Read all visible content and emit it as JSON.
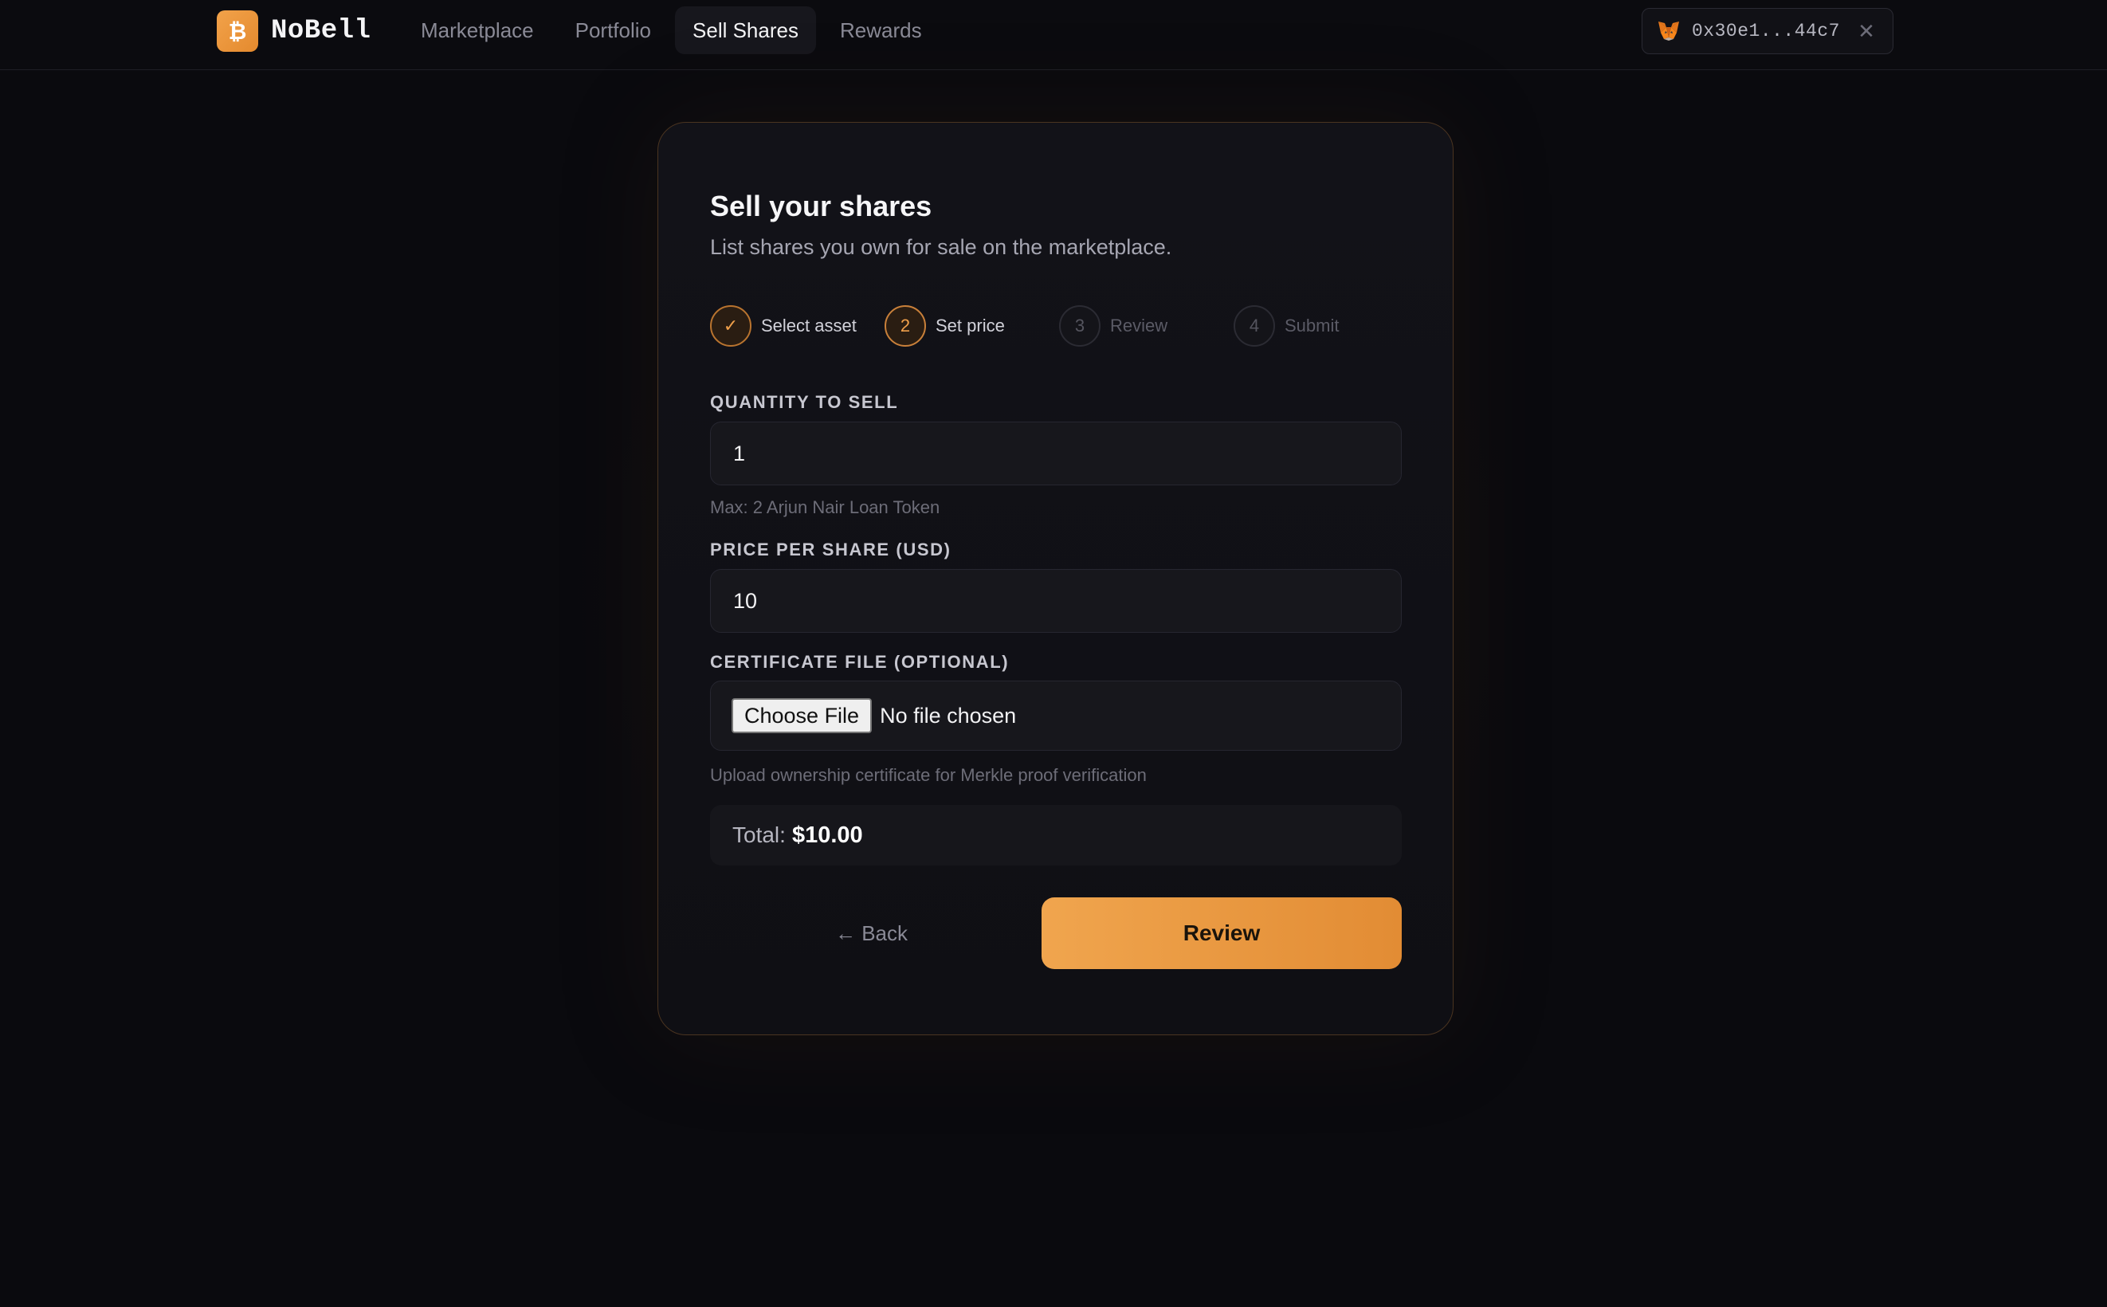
{
  "header": {
    "brand_name": "NoBell",
    "brand_icon": "bitcoin-icon",
    "nav": [
      {
        "label": "Marketplace",
        "active": false
      },
      {
        "label": "Portfolio",
        "active": false
      },
      {
        "label": "Sell Shares",
        "active": true
      },
      {
        "label": "Rewards",
        "active": false
      }
    ],
    "wallet": {
      "icon": "metamask-fox-icon",
      "address": "0x30e1...44c7",
      "close_glyph": "✕"
    }
  },
  "card": {
    "title": "Sell your shares",
    "subtitle": "List shares you own for sale on the marketplace.",
    "steps": [
      {
        "marker": "✓",
        "label": "Select asset",
        "state": "done"
      },
      {
        "marker": "2",
        "label": "Set price",
        "state": "active"
      },
      {
        "marker": "3",
        "label": "Review",
        "state": "pending"
      },
      {
        "marker": "4",
        "label": "Submit",
        "state": "pending"
      }
    ],
    "quantity": {
      "label": "QUANTITY TO SELL",
      "value": "1",
      "help": "Max: 2 Arjun Nair Loan Token"
    },
    "price": {
      "label": "PRICE PER SHARE (USD)",
      "value": "10"
    },
    "certificate": {
      "label": "CERTIFICATE FILE (OPTIONAL)",
      "button": "Choose File",
      "status": "No file chosen",
      "help": "Upload ownership certificate for Merkle proof verification"
    },
    "total": {
      "label": "Total:",
      "value": "$10.00"
    },
    "back_label": "← Back",
    "review_label": "Review"
  },
  "colors": {
    "accent": "#f0a04b",
    "background": "#0a0a0e",
    "card_border": "#4a3420"
  }
}
